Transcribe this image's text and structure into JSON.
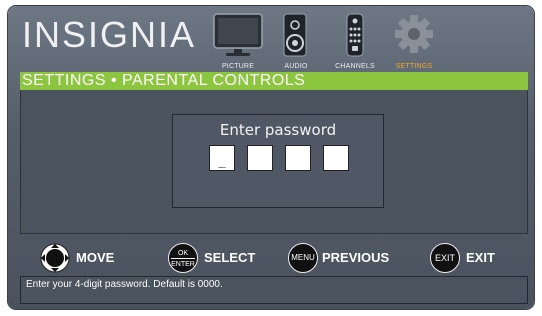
{
  "brand": "INSIGNIA",
  "menu": [
    {
      "label": "PICTURE",
      "icon": "tv-icon",
      "active": false
    },
    {
      "label": "AUDIO",
      "icon": "speaker-icon",
      "active": false
    },
    {
      "label": "CHANNELS",
      "icon": "remote-icon",
      "active": false
    },
    {
      "label": "SETTINGS",
      "icon": "gear-icon",
      "active": true
    }
  ],
  "title": "SETTINGS • PARENTAL CONTROLS",
  "password": {
    "prompt": "Enter password",
    "digits": [
      "_",
      "",
      "",
      ""
    ]
  },
  "controls": [
    {
      "button": "",
      "label": "MOVE",
      "icon": "dpad-icon"
    },
    {
      "button": "OK\nENTER",
      "label": "SELECT",
      "icon": "ok-enter-icon"
    },
    {
      "button": "MENU",
      "label": "PREVIOUS",
      "icon": "menu-button-icon"
    },
    {
      "button": "EXIT",
      "label": "EXIT",
      "icon": "exit-button-icon"
    }
  ],
  "hint": "Enter your 4-digit password. Default is 0000.",
  "colors": {
    "accent_green": "#8cc63f",
    "active_label": "#f4a623",
    "panel": "#4b535f"
  }
}
